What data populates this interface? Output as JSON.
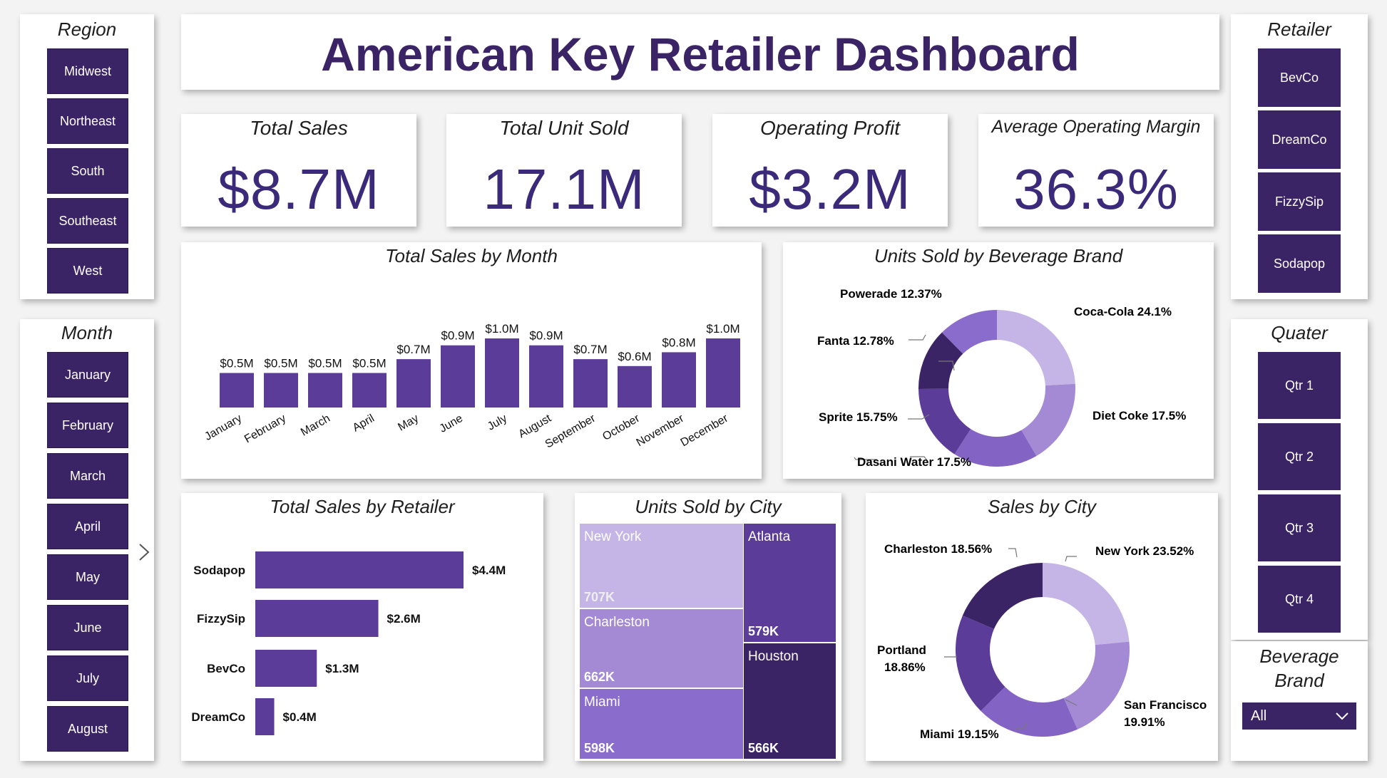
{
  "title": "American Key Retailer Dashboard",
  "region": {
    "title": "Region",
    "items": [
      "Midwest",
      "Northeast",
      "South",
      "Southeast",
      "West"
    ]
  },
  "month_slicer": {
    "title": "Month",
    "items": [
      "January",
      "February",
      "March",
      "April",
      "May",
      "June",
      "July",
      "August"
    ]
  },
  "retailer_slicer": {
    "title": "Retailer",
    "items": [
      "BevCo",
      "DreamCo",
      "FizzySip",
      "Sodapop"
    ]
  },
  "quarter_slicer": {
    "title": "Quater",
    "items": [
      "Qtr 1",
      "Qtr 2",
      "Qtr 3",
      "Qtr 4"
    ]
  },
  "brand_slicer": {
    "title_line1": "Beverage",
    "title_line2": "Brand",
    "selected": "All"
  },
  "kpis": {
    "total_sales": {
      "label": "Total Sales",
      "value": "$8.7M"
    },
    "total_units": {
      "label": "Total Unit Sold",
      "value": "17.1M"
    },
    "operating_profit": {
      "label": "Operating Profit",
      "value": "$3.2M"
    },
    "avg_margin": {
      "label": "Average Operating Margin",
      "value": "36.3%"
    }
  },
  "colors": {
    "accent": "#5b3c99",
    "dark": "#3b2466",
    "kpi_text": "#3b2a7a"
  },
  "chart_data": [
    {
      "type": "bar",
      "title": "Total Sales by Month",
      "categories": [
        "January",
        "February",
        "March",
        "April",
        "May",
        "June",
        "July",
        "August",
        "September",
        "October",
        "November",
        "December"
      ],
      "values": [
        0.5,
        0.5,
        0.5,
        0.5,
        0.7,
        0.9,
        1.0,
        0.9,
        0.7,
        0.6,
        0.8,
        1.0
      ],
      "heights": [
        47,
        45,
        45,
        46,
        63,
        84,
        97,
        88,
        63,
        58,
        74,
        97
      ],
      "labels": [
        "$0.5M",
        "$0.5M",
        "$0.5M",
        "$0.5M",
        "$0.7M",
        "$0.9M",
        "$1.0M",
        "$0.9M",
        "$0.7M",
        "$0.6M",
        "$0.8M",
        "$1.0M"
      ],
      "color": "#5b3c99"
    },
    {
      "type": "pie",
      "title": "Units Sold by Beverage Brand",
      "slices": [
        {
          "name": "Coca-Cola",
          "value": 24.1,
          "label": "Coca-Cola 24.1%",
          "color": "#c5b5e6"
        },
        {
          "name": "Diet Coke",
          "value": 17.5,
          "label": "Diet Coke 17.5%",
          "color": "#a48ad4"
        },
        {
          "name": "Dasani Water",
          "value": 17.5,
          "label": "Dasani Water 17.5%",
          "color": "#8364c4"
        },
        {
          "name": "Sprite",
          "value": 15.75,
          "label": "Sprite 15.75%",
          "color": "#5b3c99"
        },
        {
          "name": "Fanta",
          "value": 12.78,
          "label": "Fanta 12.78%",
          "color": "#3b2466"
        },
        {
          "name": "Powerade",
          "value": 12.37,
          "label": "Powerade 12.37%",
          "color": "#8a6ccc"
        }
      ]
    },
    {
      "type": "bar",
      "orientation": "horizontal",
      "title": "Total Sales by Retailer",
      "categories": [
        "Sodapop",
        "FizzySip",
        "BevCo",
        "DreamCo"
      ],
      "values": [
        4.4,
        2.6,
        1.3,
        0.4
      ],
      "labels": [
        "$4.4M",
        "$2.6M",
        "$1.3M",
        "$0.4M"
      ],
      "color": "#5b3c99"
    },
    {
      "type": "treemap",
      "title": "Units Sold by City",
      "items": [
        {
          "name": "New York",
          "value": "707K"
        },
        {
          "name": "Charleston",
          "value": "662K"
        },
        {
          "name": "Miami",
          "value": "598K"
        },
        {
          "name": "Atlanta",
          "value": "579K"
        },
        {
          "name": "Houston",
          "value": "566K"
        }
      ]
    },
    {
      "type": "pie",
      "title": "Sales by City",
      "slices": [
        {
          "name": "New York",
          "value": 23.52,
          "label": "New York 23.52%",
          "color": "#c5b5e6"
        },
        {
          "name": "San Francisco",
          "value": 19.91,
          "label": "San Francisco 19.91%",
          "color": "#a48ad4"
        },
        {
          "name": "Miami",
          "value": 19.15,
          "label": "Miami 19.15%",
          "color": "#8364c4"
        },
        {
          "name": "Portland",
          "value": 18.86,
          "label": "Portland 18.86%",
          "color": "#5b3c99"
        },
        {
          "name": "Charleston",
          "value": 18.56,
          "label": "Charleston 18.56%",
          "color": "#3b2466"
        }
      ]
    }
  ],
  "labels": {
    "brand_pie": {
      "cocacola": "Coca-Cola 24.1%",
      "dietcoke": "Diet Coke 17.5%",
      "dasani": "Dasani Water 17.5%",
      "sprite": "Sprite 15.75%",
      "fanta": "Fanta 12.78%",
      "powerade": "Powerade 12.37%"
    },
    "city_pie": {
      "newyork": "New York 23.52%",
      "sanfrancisco_1": "San Francisco",
      "sanfrancisco_2": "19.91%",
      "miami": "Miami 19.15%",
      "portland_1": "Portland",
      "portland_2": "18.86%",
      "charleston": "Charleston 18.56%"
    }
  }
}
